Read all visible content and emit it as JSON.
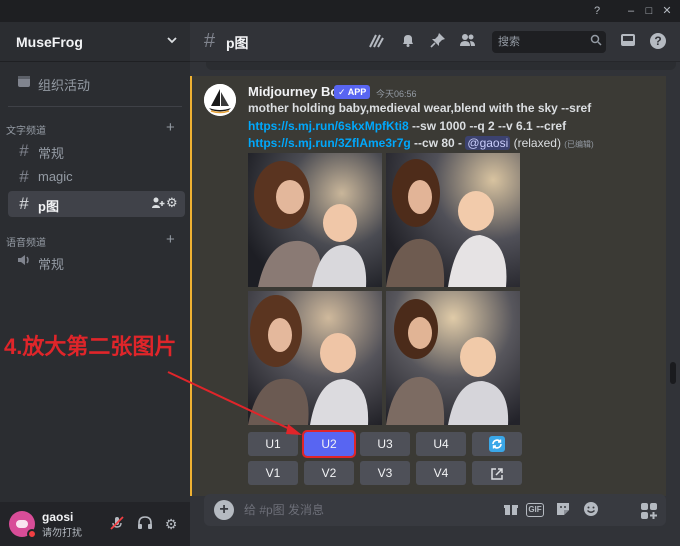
{
  "window": {
    "controls": [
      "?",
      "–",
      "□",
      "✕"
    ]
  },
  "sidebar": {
    "server_name": "MuseFrog",
    "events_label": "组织活动",
    "text_category": "文字频道",
    "text_channels": [
      {
        "label": "常规"
      },
      {
        "label": "magic"
      },
      {
        "label": "p图",
        "active": true
      }
    ],
    "voice_category": "语音频道",
    "voice_channels": [
      {
        "label": "常规"
      }
    ]
  },
  "user": {
    "name": "gaosi",
    "status": "请勿打扰",
    "avatar_color": "#d84d98",
    "status_color": "#f23f43"
  },
  "header": {
    "channel": "p图",
    "search_placeholder": "搜索",
    "icons": [
      "threads-icon",
      "bell-icon",
      "pin-icon",
      "members-icon",
      "inbox-icon",
      "help-icon"
    ]
  },
  "message": {
    "author": "Midjourney Bot",
    "badge": "✓ APP",
    "timestamp": "今天06:56",
    "prompt": "mother holding baby,medieval wear,blend with the sky --sref",
    "sref_link": "https://s.mj.run/6skxMpfKti8",
    "sref_params": " --sw 1000 --q 2 --v 6.1 --cref",
    "cref_link": "https://s.mj.run/3ZflAme3r7g",
    "cref_params": " --cw 80 - ",
    "mention": "@gaosi",
    "mode": " (relaxed) ",
    "edited": "(已编辑)"
  },
  "buttons": {
    "upscale": [
      "U1",
      "U2",
      "U3",
      "U4"
    ],
    "variation": [
      "V1",
      "V2",
      "V3",
      "V4"
    ],
    "selected": "U2",
    "selected_color": "#5865f2",
    "highlight_color": "#e0252a"
  },
  "annotation": {
    "text": "4.放大第二张图片",
    "color": "#e0252a"
  },
  "composer": {
    "placeholder": "给 #p图 发消息",
    "gif_label": "GIF"
  },
  "colors": {
    "accent": "#5865f2",
    "link": "#00a8fc",
    "highlight_bar": "#f0b232"
  }
}
